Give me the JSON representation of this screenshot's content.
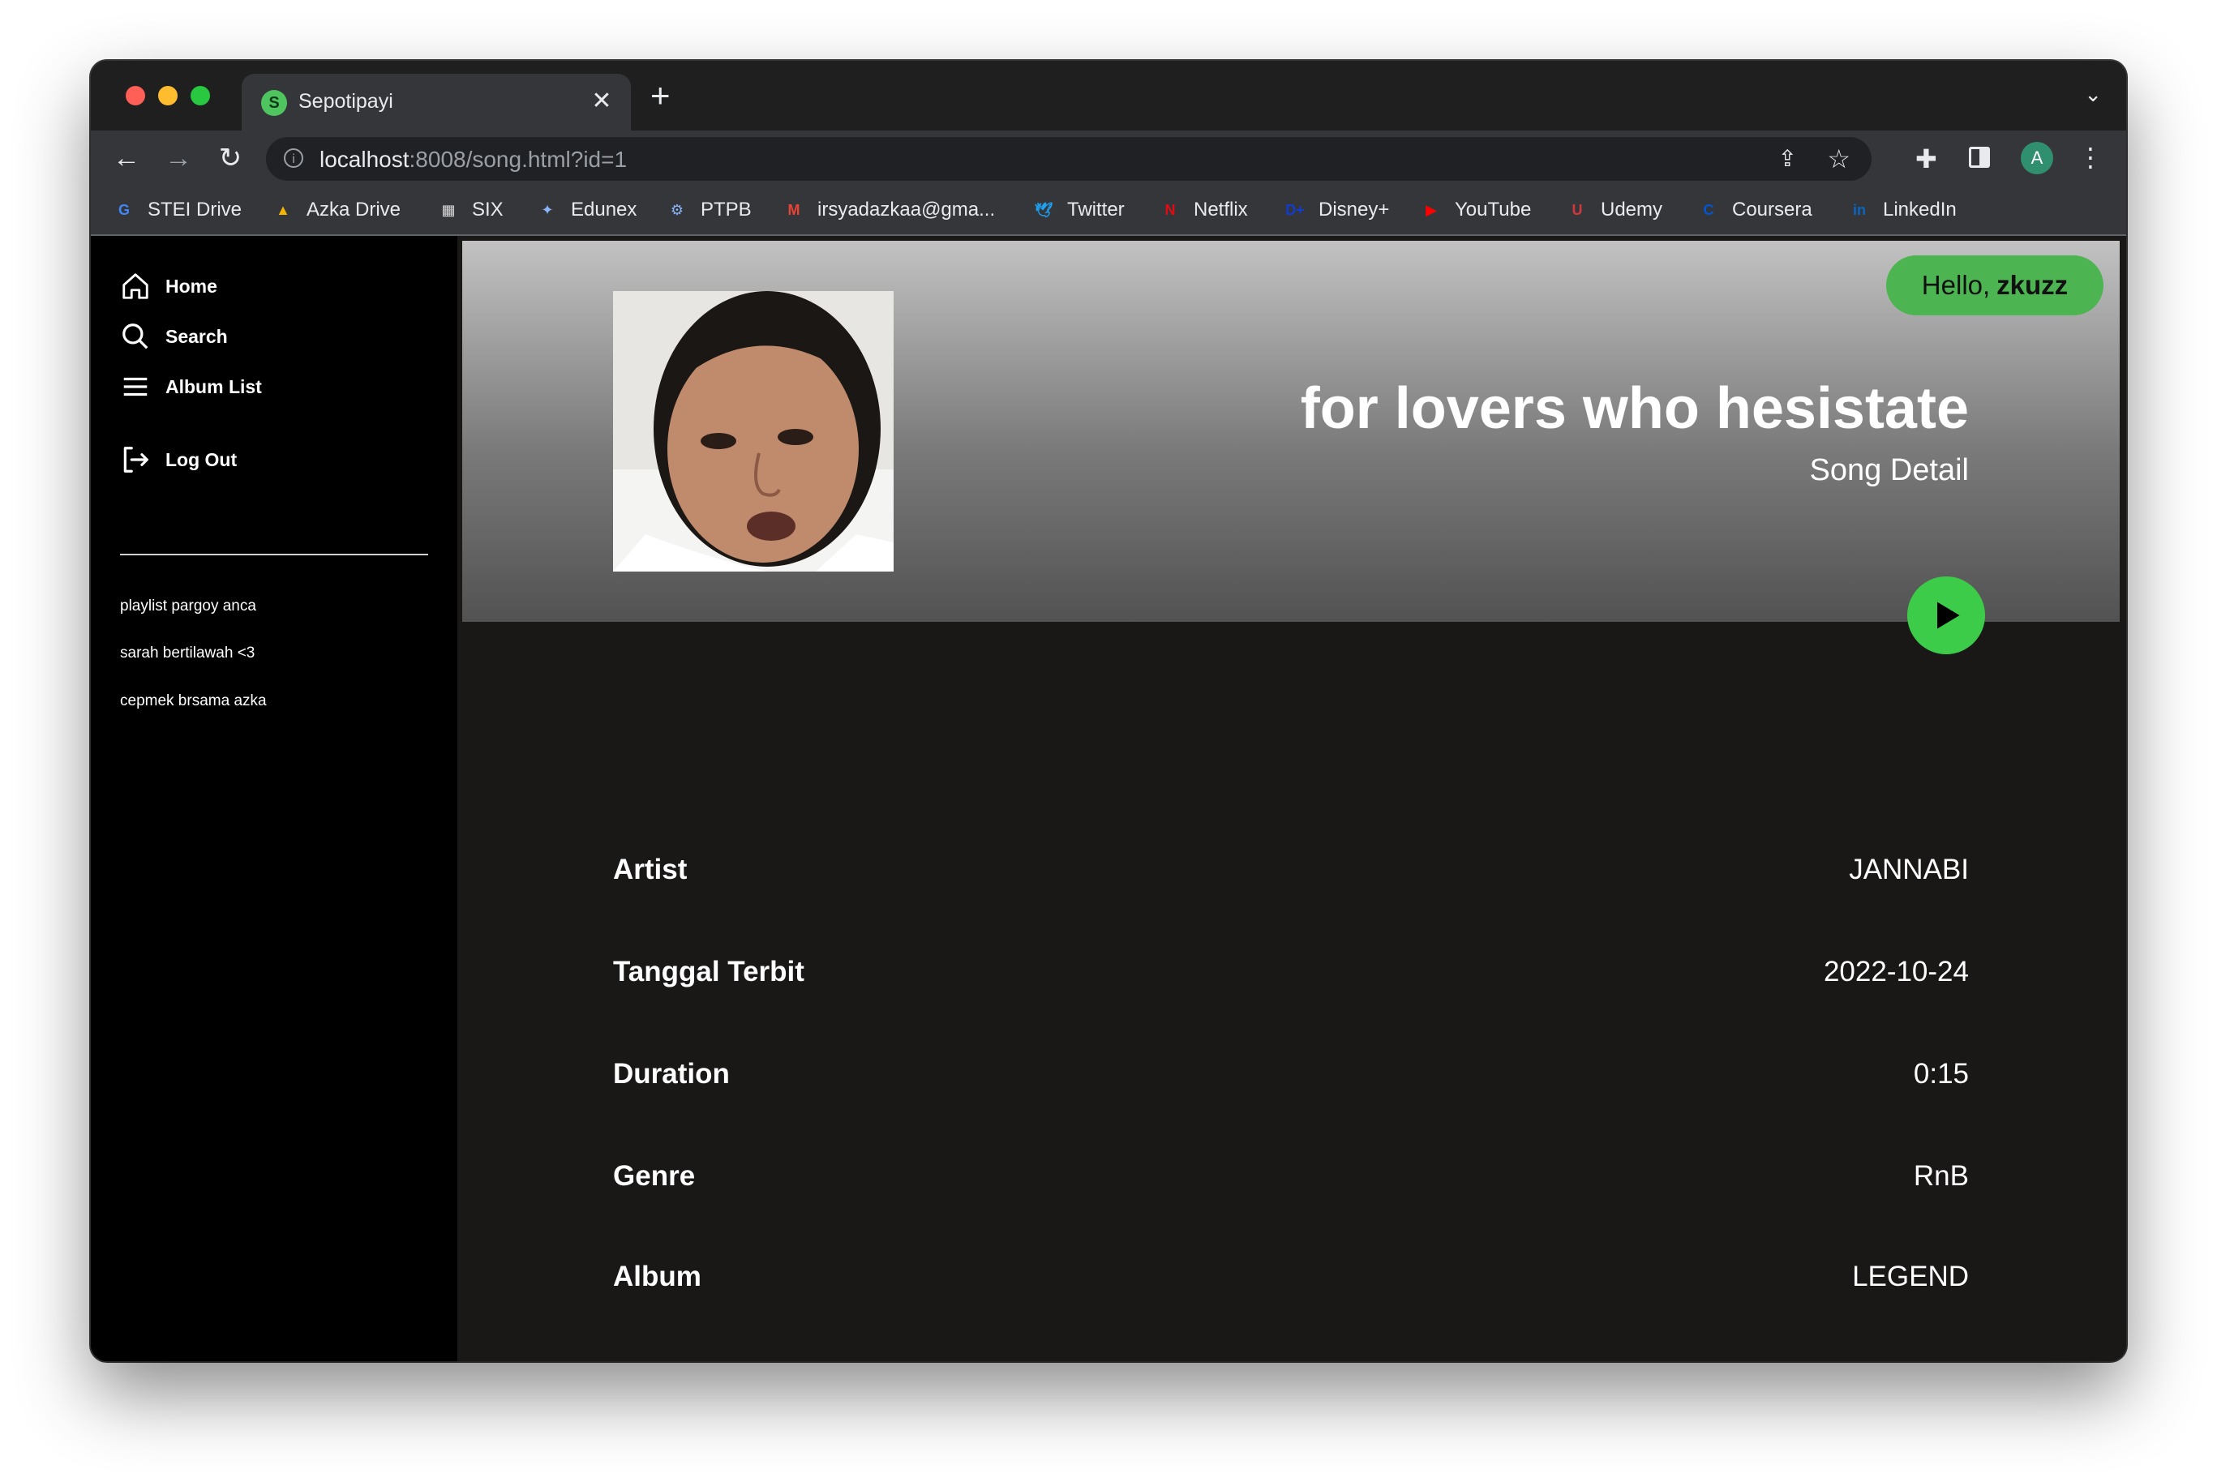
{
  "browser": {
    "tab": {
      "title": "Sepotipayi",
      "favicon_letter": "S"
    },
    "url": {
      "host": "localhost",
      "rest": ":8008/song.html?id=1"
    },
    "profile_initial": "A",
    "bookmarks": [
      {
        "label": "STEI Drive",
        "icon": "google-icon",
        "glyph": "G",
        "color": "#4285f4"
      },
      {
        "label": "Azka Drive",
        "icon": "drive-icon",
        "glyph": "▲",
        "color": "#f4b400"
      },
      {
        "label": "SIX",
        "icon": "six-icon",
        "glyph": "▦",
        "color": "#dddddd"
      },
      {
        "label": "Edunex",
        "icon": "edunex-icon",
        "glyph": "✦",
        "color": "#8ab4f8"
      },
      {
        "label": "PTPB",
        "icon": "ptpb-icon",
        "glyph": "⚙",
        "color": "#8ab4f8"
      },
      {
        "label": "irsyadazkaa@gma...",
        "icon": "gmail-icon",
        "glyph": "M",
        "color": "#ea4335"
      },
      {
        "label": "Twitter",
        "icon": "twitter-icon",
        "glyph": "🕊",
        "color": "#1da1f2"
      },
      {
        "label": "Netflix",
        "icon": "netflix-icon",
        "glyph": "N",
        "color": "#e50914"
      },
      {
        "label": "Disney+",
        "icon": "disney-icon",
        "glyph": "D+",
        "color": "#113ccf"
      },
      {
        "label": "YouTube",
        "icon": "youtube-icon",
        "glyph": "▶",
        "color": "#ff0000"
      },
      {
        "label": "Udemy",
        "icon": "udemy-icon",
        "glyph": "U",
        "color": "#d2383a"
      },
      {
        "label": "Coursera",
        "icon": "coursera-icon",
        "glyph": "C",
        "color": "#0056d2"
      },
      {
        "label": "LinkedIn",
        "icon": "linkedin-icon",
        "glyph": "in",
        "color": "#0a66c2"
      }
    ]
  },
  "sidebar": {
    "nav": [
      {
        "label": "Home",
        "icon": "home-icon"
      },
      {
        "label": "Search",
        "icon": "search-icon"
      },
      {
        "label": "Album List",
        "icon": "menu-icon"
      }
    ],
    "logout": {
      "label": "Log Out",
      "icon": "logout-icon"
    },
    "playlists": [
      "playlist pargoy anca",
      "sarah bertilawah <3",
      "cepmek brsama azka"
    ]
  },
  "header": {
    "greeting": "Hello,",
    "username": "zkuzz",
    "title": "for lovers who hesistate",
    "subtitle": "Song Detail"
  },
  "details": [
    {
      "label": "Artist",
      "value": "JANNABI"
    },
    {
      "label": "Tanggal Terbit",
      "value": "2022-10-24"
    },
    {
      "label": "Duration",
      "value": "0:15"
    },
    {
      "label": "Genre",
      "value": "RnB"
    },
    {
      "label": "Album",
      "value": "LEGEND"
    }
  ],
  "colors": {
    "accent": "#4cb450",
    "play": "#3dcc4a",
    "page_bg": "#1a1717",
    "sidebar_bg": "#000000"
  }
}
